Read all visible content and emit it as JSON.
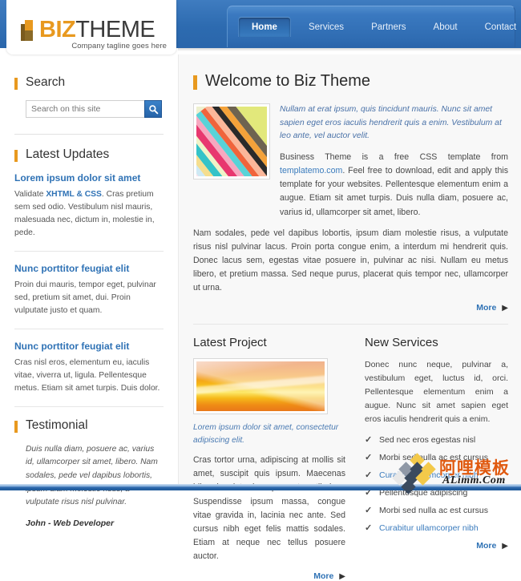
{
  "site": {
    "logo_mark": "book-logo-icon",
    "logo_primary": "BIZ",
    "logo_secondary": "THEME",
    "tagline": "Company tagline goes here"
  },
  "nav": {
    "items": [
      {
        "label": "Home",
        "active": true
      },
      {
        "label": "Services",
        "active": false
      },
      {
        "label": "Partners",
        "active": false
      },
      {
        "label": "About",
        "active": false
      },
      {
        "label": "Contact",
        "active": false
      }
    ]
  },
  "sidebar": {
    "search": {
      "heading": "Search",
      "placeholder": "Search on this site",
      "value": "",
      "button_icon": "search-icon"
    },
    "updates": {
      "heading": "Latest Updates",
      "items": [
        {
          "title": "Lorem ipsum dolor sit amet",
          "text_before": "Validate ",
          "link": "XHTML & CSS",
          "text_after": ". Cras pretium sem sed odio. Vestibulum nisl mauris, malesuada nec, dictum in, molestie in, pede."
        },
        {
          "title": "Nunc porttitor feugiat elit",
          "text_before": "",
          "link": "",
          "text_after": "Proin dui mauris, tempor eget, pulvinar sed, pretium sit amet, dui. Proin vulputate justo et quam."
        },
        {
          "title": "Nunc porttitor feugiat elit",
          "text_before": "",
          "link": "",
          "text_after": "Cras nisl eros, elementum eu, iaculis vitae, viverra ut, ligula. Pellentesque metus. Etiam sit amet turpis. Duis dolor."
        }
      ]
    },
    "testimonial": {
      "heading": "Testimonial",
      "quote": "Duis nulla diam, posuere ac, varius id, ullamcorper sit amet, libero. Nam sodales, pede vel dapibus lobortis, ipsum diam molestie risus, a vulputate risus nisl pulvinar.",
      "author": "John - Web Developer"
    }
  },
  "content": {
    "heading": "Welcome to Biz Theme",
    "thumb_alt": "colorful-stripes-image",
    "lead": "Nullam at erat ipsum, quis tincidunt mauris. Nunc sit amet sapien eget eros iaculis hendrerit quis a enim. Vestibulum at leo ante, vel auctor velit.",
    "para1_before": "Business Theme is a free CSS template from ",
    "para1_link": "templatemo.com",
    "para1_after": ". Feel free to download, edit and apply this template for your websites. Pellentesque elementum enim a augue. Etiam sit amet turpis. Duis nulla diam, posuere ac, varius id, ullamcorper sit amet, libero.",
    "para2": "Nam sodales, pede vel dapibus lobortis, ipsum diam molestie risus, a vulputate risus nisl pulvinar lacus. Proin porta congue enim, a interdum mi hendrerit quis. Donec lacus sem, egestas vitae posuere in, pulvinar ac nisi. Nullam eu metus libero, et pretium massa. Sed neque purus, placerat quis tempor nec, ullamcorper ut urna.",
    "more_label": "More",
    "more_arrow": "▶",
    "project": {
      "heading": "Latest Project",
      "image_alt": "orange-wave-image",
      "caption": "Lorem ipsum dolor sit amet, consectetur adipiscing elit.",
      "text": "Cras tortor urna, adipiscing at mollis sit amet, suscipit quis ipsum. Maecenas bibendum interdum quam at vestibulum. Suspendisse ipsum massa, congue vitae gravida in, lacinia nec ante. Sed cursus nibh eget felis mattis sodales. Etiam at neque nec tellus posuere auctor.",
      "more_label": "More"
    },
    "services": {
      "heading": "New Services",
      "text": "Donec nunc neque, pulvinar a, vestibulum eget, luctus id, orci. Pellentesque elementum enim a augue. Nunc sit amet sapien eget eros iaculis hendrerit quis a enim.",
      "items": [
        {
          "label": "Sed nec eros egestas nisl",
          "is_link": false
        },
        {
          "label": "Morbi sed nulla ac est cursus",
          "is_link": false
        },
        {
          "label": "Curabitur ullamcorper nibh",
          "is_link": true
        },
        {
          "label": "Pellentesque adipiscing",
          "is_link": false
        },
        {
          "label": "Morbi sed nulla ac est cursus",
          "is_link": false
        },
        {
          "label": "Curabitur ullamcorper nibh",
          "is_link": true
        }
      ],
      "more_label": "More"
    }
  },
  "watermark": {
    "cn_text": "阿哩模板",
    "en_text": "ALimm.Com",
    "icon": "diamond-cluster-logo"
  },
  "colors": {
    "accent_orange": "#e8991f",
    "brand_blue": "#2a66ab",
    "link_blue": "#2f72b5",
    "content_bg": "#f8f8f8"
  }
}
